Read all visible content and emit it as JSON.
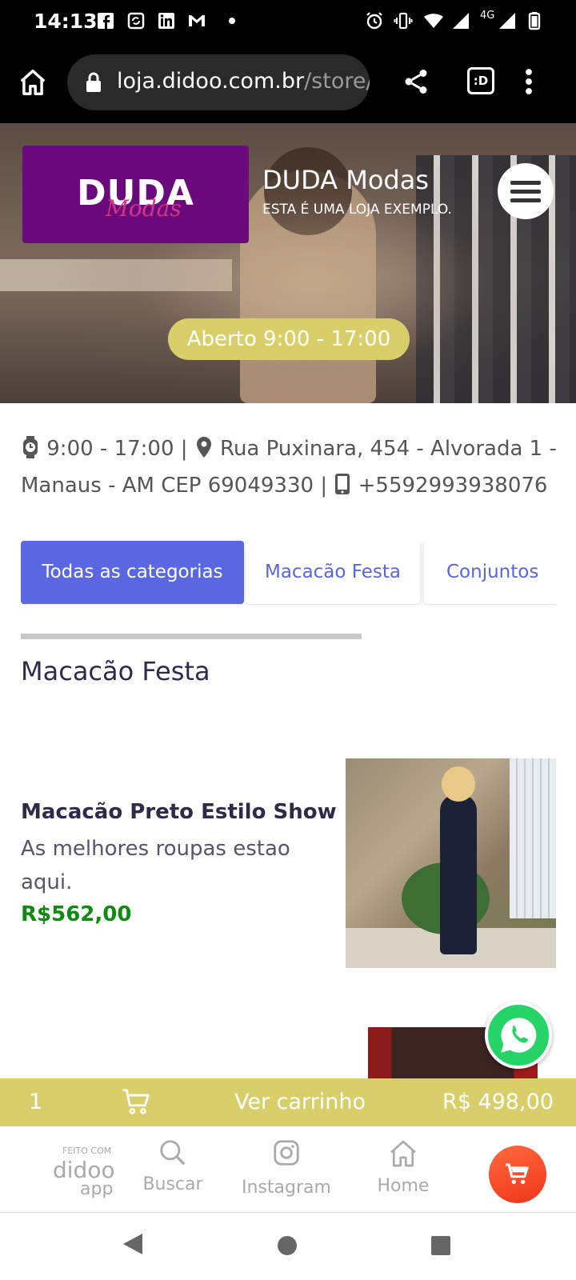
{
  "status_bar": {
    "time": "14:13",
    "network_label": "4G",
    "icons": [
      "facebook-icon",
      "sync-icon",
      "linkedin-icon",
      "gmail-icon",
      "dot-icon",
      "alarm-icon",
      "vibrate-icon",
      "wifi-icon",
      "signal-icon",
      "signal-4g-icon",
      "battery-icon"
    ]
  },
  "browser": {
    "url_host": "loja.didoo.com.br",
    "url_path": "/store/",
    "icons": [
      "home-icon",
      "lock-icon",
      "share-icon",
      "tab-switcher-icon",
      "more-vert-icon"
    ],
    "tab_switcher_label": ":D"
  },
  "hero": {
    "logo_main": "DUDA",
    "logo_script": "Modas",
    "store_name": "DUDA Modas",
    "store_subtitle": "ESTA É UMA LOJA EXEMPLO.",
    "open_status": "Aberto 9:00 - 17:00"
  },
  "info": {
    "hours": "9:00 - 17:00 |",
    "address": "Rua Puxinara, 454 - Alvorada 1 - Manaus - AM CEP 69049330 |",
    "phone": "+5592993938076"
  },
  "tabs": [
    {
      "label": "Todas as categorias",
      "active": true
    },
    {
      "label": "Macacão Festa",
      "active": false
    },
    {
      "label": "Conjuntos",
      "active": false
    }
  ],
  "section": {
    "title": "Macacão Festa"
  },
  "products": [
    {
      "name": "Macacão Preto Estilo Show",
      "description": "As melhores roupas estao aqui.",
      "price": "R$562,00"
    }
  ],
  "cart_bar": {
    "count": "1",
    "label": "Ver carrinho",
    "total": "R$ 498,00"
  },
  "bottom_nav": {
    "made_with": "FEITO COM",
    "brand_line1": "didoo",
    "brand_line2": "app",
    "items": [
      {
        "label": "Buscar",
        "icon": "search-icon"
      },
      {
        "label": "Instagram",
        "icon": "instagram-icon"
      },
      {
        "label": "Home",
        "icon": "home-icon"
      }
    ]
  },
  "colors": {
    "accent_tab": "#5a67e0",
    "yellow_bar": "#d8cf6b",
    "price_green": "#118a11",
    "logo_purple": "#6a0a7d",
    "whatsapp_green": "#25d366",
    "cart_fab": "#f0361b"
  }
}
